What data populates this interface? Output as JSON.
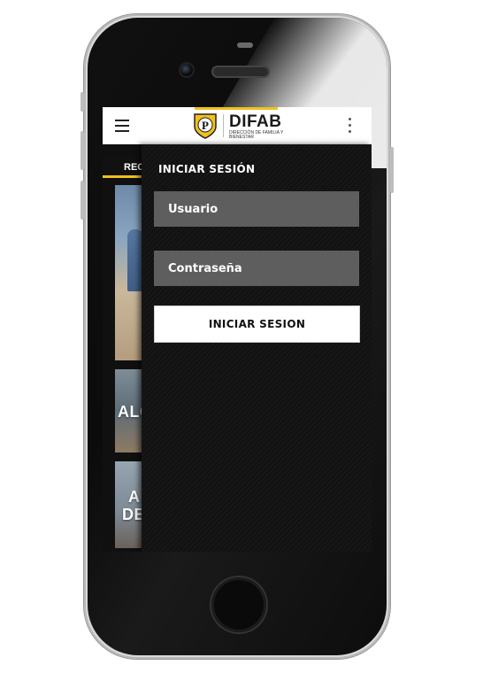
{
  "header": {
    "brand_name": "DIFAB",
    "brand_subtitle": "DIRECCIÓN DE FAMILIA Y BIENESTAR",
    "logo_letter": "P",
    "menu_icon": "hamburger-menu-icon",
    "overflow_icon": "more-vertical-icon",
    "accent_color": "#f2c01e"
  },
  "background": {
    "tab_label": "REC",
    "card2_text": "ALC",
    "card3_line1": "A",
    "card3_line2": "DE"
  },
  "login": {
    "title": "INICIAR SESIÓN",
    "username_placeholder": "Usuario",
    "password_placeholder": "Contraseña",
    "submit_label": "INICIAR SESION"
  }
}
